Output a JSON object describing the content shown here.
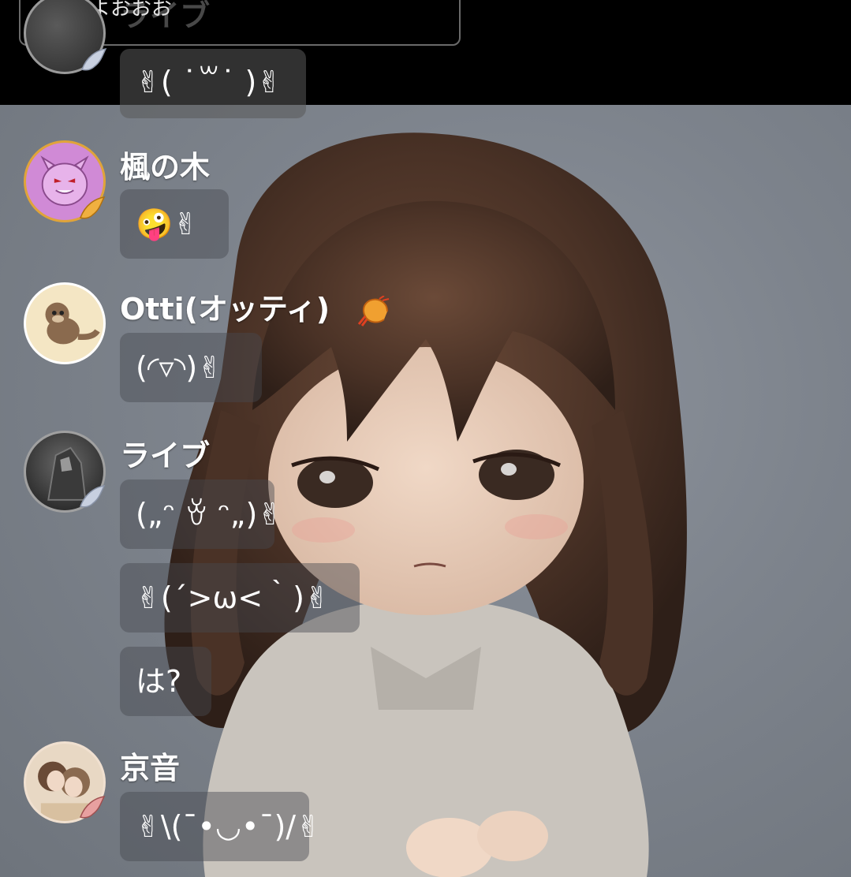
{
  "top_preview": {
    "text": "おはよおおお",
    "ghost_name": "ライブ",
    "partial_message": "✌( ˙꒳​˙ )✌"
  },
  "messages": [
    {
      "user": "楓の木",
      "text": "🤪✌"
    },
    {
      "user": "Otti(オッティ)",
      "text": "(◜▿◝)✌"
    },
    {
      "user": "ライブ",
      "texts": [
        "(„ᵔ ꈊ ᵔ„)✌",
        "✌(´>ω<｀)✌",
        "は?"
      ]
    },
    {
      "user": "京音",
      "text": "✌\\(¯•◡•¯)/✌"
    }
  ],
  "colors": {
    "topbar": "#000000",
    "bubble": "rgba(70,74,80,0.45)",
    "avatar_border_gold": "#e0a43a"
  }
}
